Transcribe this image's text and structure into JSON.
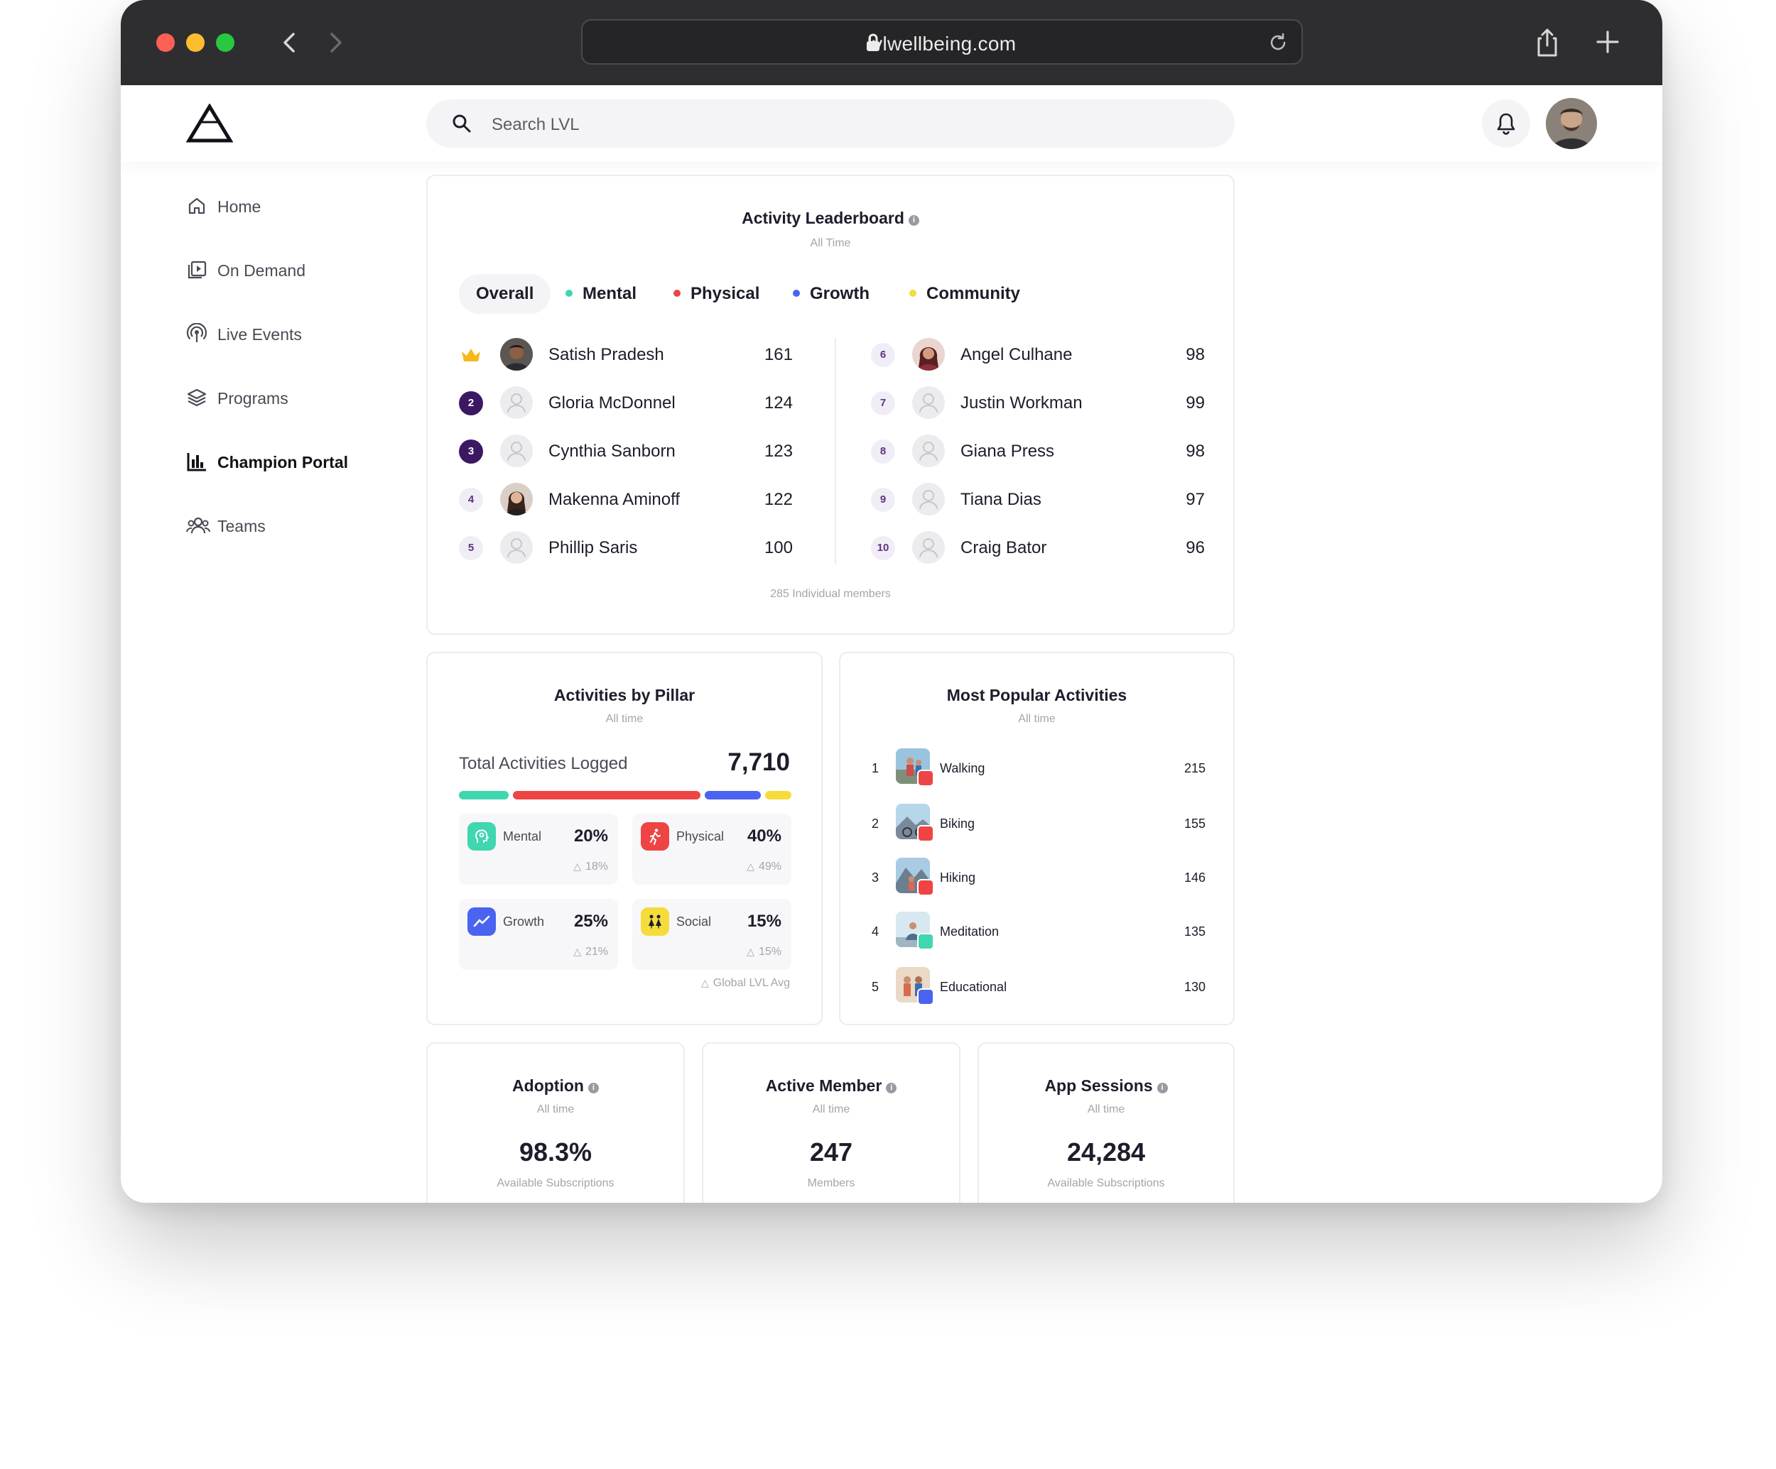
{
  "browser": {
    "url": "lvlwellbeing.com"
  },
  "header": {
    "search_placeholder": "Search LVL"
  },
  "sidebar": {
    "items": [
      {
        "label": "Home",
        "icon": "home-icon",
        "active": false
      },
      {
        "label": "On Demand",
        "icon": "play-library-icon",
        "active": false
      },
      {
        "label": "Live Events",
        "icon": "broadcast-icon",
        "active": false
      },
      {
        "label": "Programs",
        "icon": "layers-icon",
        "active": false
      },
      {
        "label": "Champion Portal",
        "icon": "bar-chart-icon",
        "active": true
      },
      {
        "label": "Teams",
        "icon": "people-icon",
        "active": false
      }
    ]
  },
  "leaderboard": {
    "title": "Activity Leaderboard",
    "subtitle": "All Time",
    "tabs": [
      {
        "label": "Overall",
        "color": "",
        "active": true
      },
      {
        "label": "Mental",
        "color": "#3fd6b0",
        "active": false
      },
      {
        "label": "Physical",
        "color": "#ef4444",
        "active": false
      },
      {
        "label": "Growth",
        "color": "#4a63f0",
        "active": false
      },
      {
        "label": "Community",
        "color": "#f5dc3a",
        "active": false
      }
    ],
    "entries": [
      {
        "rank": "1",
        "name": "Satish Pradesh",
        "score": "161"
      },
      {
        "rank": "2",
        "name": "Gloria McDonnel",
        "score": "124"
      },
      {
        "rank": "3",
        "name": "Cynthia Sanborn",
        "score": "123"
      },
      {
        "rank": "4",
        "name": "Makenna Aminoff",
        "score": "122"
      },
      {
        "rank": "5",
        "name": "Phillip Saris",
        "score": "100"
      },
      {
        "rank": "6",
        "name": "Angel Culhane",
        "score": "98"
      },
      {
        "rank": "7",
        "name": "Justin Workman",
        "score": "99"
      },
      {
        "rank": "8",
        "name": "Giana Press",
        "score": "98"
      },
      {
        "rank": "9",
        "name": "Tiana Dias",
        "score": "97"
      },
      {
        "rank": "10",
        "name": "Craig Bator",
        "score": "96"
      }
    ],
    "footer": "285 Individual members"
  },
  "pillar": {
    "title": "Activities by Pillar",
    "subtitle": "All time",
    "total_label": "Total Activities Logged",
    "total_value": "7,710",
    "breakdown": [
      {
        "label": "Mental",
        "pct": "20%",
        "avg": "18%",
        "share": 15,
        "color": "#3fd6b0",
        "icon": "mental-head-icon"
      },
      {
        "label": "Physical",
        "pct": "40%",
        "avg": "49%",
        "share": 57,
        "color": "#ef4444",
        "icon": "running-icon"
      },
      {
        "label": "Growth",
        "pct": "25%",
        "avg": "21%",
        "share": 17,
        "color": "#4a63f0",
        "icon": "trend-up-icon"
      },
      {
        "label": "Social",
        "pct": "15%",
        "avg": "15%",
        "share": 8,
        "color": "#f5dc3a",
        "icon": "social-people-icon"
      }
    ],
    "legend": "Global LVL Avg"
  },
  "popular": {
    "title": "Most Popular Activities",
    "subtitle": "All time",
    "items": [
      {
        "rank": "1",
        "name": "Walking",
        "count": "215",
        "badge_color": "#ef4444"
      },
      {
        "rank": "2",
        "name": "Biking",
        "count": "155",
        "badge_color": "#ef4444"
      },
      {
        "rank": "3",
        "name": "Hiking",
        "count": "146",
        "badge_color": "#ef4444"
      },
      {
        "rank": "4",
        "name": "Meditation",
        "count": "135",
        "badge_color": "#3fd6b0"
      },
      {
        "rank": "5",
        "name": "Educational",
        "count": "130",
        "badge_color": "#4a63f0"
      }
    ]
  },
  "stats": [
    {
      "title": "Adoption",
      "subtitle": "All time",
      "value": "98.3%",
      "note": "Available Subscriptions"
    },
    {
      "title": "Active Member",
      "subtitle": "All time",
      "value": "247",
      "note": "Members"
    },
    {
      "title": "App Sessions",
      "subtitle": "All time",
      "value": "24,284",
      "note": "Available Subscriptions"
    }
  ]
}
